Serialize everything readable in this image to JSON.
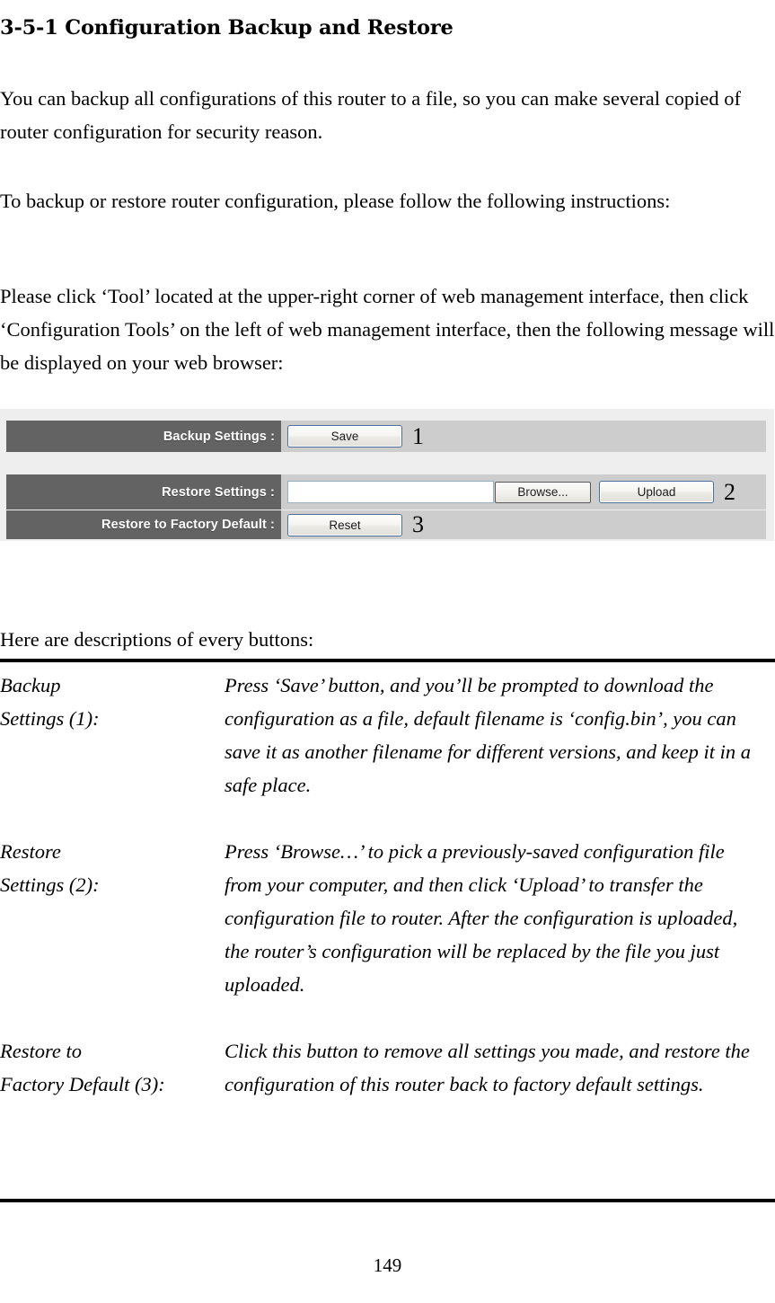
{
  "document": {
    "heading": "3-5-1 Configuration Backup and Restore",
    "paragraphs": {
      "p1": "You can backup all configurations of this router to a file, so you can make several copied of router configuration for security reason.",
      "p2": "To backup or restore router configuration, please follow the following instructions:",
      "p3": "Please click ‘Tool’ located at the upper-right corner of web management interface, then click ‘Configuration Tools’ on the left of web management interface, then the following message will be displayed on your web browser:",
      "p4": "Here are descriptions of every buttons:"
    },
    "page_number": "149"
  },
  "ui_panel": {
    "colors": {
      "panel_background": "#eeeeee",
      "row_background": "#cdcdcd",
      "label_background": "#636363",
      "label_text": "#ffffff",
      "button_border": "#4d6f99",
      "input_border": "#9aafc6"
    },
    "rows": [
      {
        "label": "Backup Settings :",
        "button": "Save",
        "callout": "1"
      },
      {
        "label": "Restore Settings :",
        "input_value": "",
        "input_placeholder": "",
        "browse_button": "Browse...",
        "upload_button": "Upload",
        "callout": "2"
      },
      {
        "label": "Restore to Factory Default :",
        "button": "Reset",
        "callout": "3"
      }
    ]
  },
  "descriptions": [
    {
      "term": "Backup\nSettings (1):",
      "definition": "Press ‘Save’ button, and you’ll be prompted to download the configuration as a file, default filename is ‘config.bin’, you can save it as another filename for different versions, and keep it in a safe place."
    },
    {
      "term": "Restore\nSettings (2):",
      "definition": "Press ‘Browse…’ to pick a previously-saved configuration file from your computer, and then click ‘Upload’ to transfer the configuration file to router. After the configuration is uploaded, the router’s configuration will be replaced by the file you just uploaded."
    },
    {
      "term": "Restore to\nFactory Default (3):",
      "definition": "Click this button to remove all settings you made, and restore the configuration of this router back to factory default settings."
    }
  ]
}
